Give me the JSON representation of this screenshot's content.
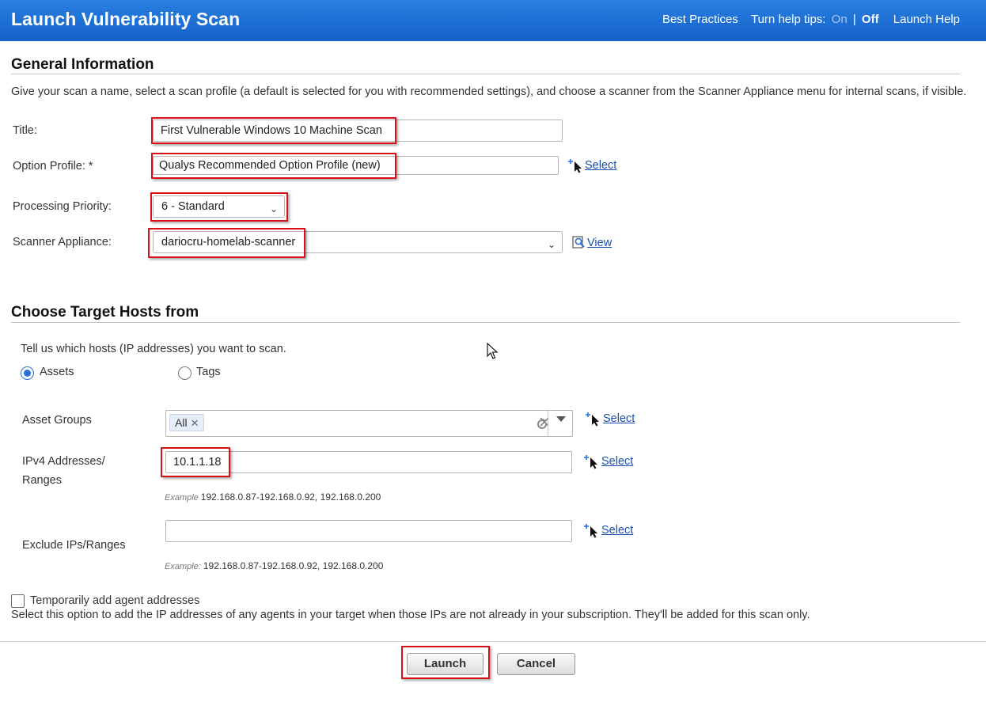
{
  "header": {
    "title": "Launch Vulnerability Scan",
    "best_practices": "Best Practices",
    "help_tips_label": "Turn help tips:",
    "help_on": "On",
    "help_sep": "|",
    "help_off": "Off",
    "launch_help": "Launch Help",
    "colors": {
      "bar": "#1462c9"
    }
  },
  "general": {
    "heading": "General Information",
    "description": "Give your scan a name, select a scan profile (a default is selected for you with recommended settings), and choose a scanner from the Scanner Appliance menu for internal scans, if visible.",
    "title_label": "Title:",
    "title_value": "First Vulnerable Windows 10 Machine Scan",
    "option_profile_label": "Option Profile: *",
    "option_profile_value": "Qualys Recommended Option Profile (new)",
    "option_profile_select": "Select",
    "priority_label": "Processing Priority:",
    "priority_value": "6 - Standard",
    "scanner_label": "Scanner Appliance:",
    "scanner_value": "dariocru-homelab-scanner",
    "scanner_view": "View"
  },
  "targets": {
    "heading": "Choose Target Hosts from",
    "prompt": "Tell us which hosts (IP addresses) you want to scan.",
    "radio_assets": "Assets",
    "radio_tags": "Tags",
    "asset_groups_label": "Asset Groups",
    "asset_groups_chip": "All",
    "asset_groups_select": "Select",
    "ipv4_label_line1": "IPv4 Addresses/",
    "ipv4_label_line2": "Ranges",
    "ipv4_value": "10.1.1.18",
    "ipv4_select": "Select",
    "ipv4_example_label": "Example",
    "ipv4_example": "192.168.0.87-192.168.0.92, 192.168.0.200",
    "exclude_label": "Exclude IPs/Ranges",
    "exclude_value": "",
    "exclude_select": "Select",
    "exclude_example_label": "Example:",
    "exclude_example": "192.168.0.87-192.168.0.92, 192.168.0.200",
    "agent_checkbox_label": "Temporarily add agent addresses",
    "agent_description": "Select this option to add the IP addresses of any agents in your target when those IPs are not already in your subscription. They'll be added for this scan only."
  },
  "footer": {
    "launch": "Launch",
    "cancel": "Cancel"
  }
}
